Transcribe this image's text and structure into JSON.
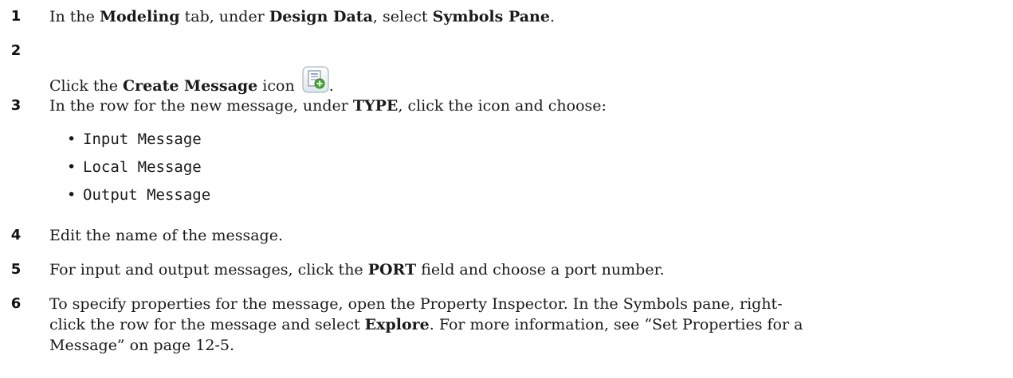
{
  "steps": [
    {
      "num": "1",
      "parts": [
        "In the ",
        "Modeling",
        " tab, under ",
        "Design Data",
        ", select ",
        "Symbols Pane",
        "."
      ]
    },
    {
      "num": "2",
      "parts": [
        "Click the ",
        "Create Message",
        " icon ",
        "."
      ],
      "icon": "create-message-icon"
    },
    {
      "num": "3",
      "parts": [
        "In the row for the new message, under ",
        "TYPE",
        ", click the icon and choose:"
      ],
      "options": [
        "Input Message",
        "Local Message",
        "Output Message"
      ]
    },
    {
      "num": "4",
      "text": "Edit the name of the message."
    },
    {
      "num": "5",
      "parts": [
        "For input and output messages, click the ",
        "PORT",
        " field and choose a port number."
      ]
    },
    {
      "num": "6",
      "line1": "To specify properties for the message, open the Property Inspector. In the Symbols pane, right-",
      "line2_parts": [
        "click the row for the message and select ",
        "Explore",
        ". For more information, see “Set Properties for a"
      ],
      "line3": "Message” on page 12-5."
    }
  ],
  "bullet_glyph": "•"
}
